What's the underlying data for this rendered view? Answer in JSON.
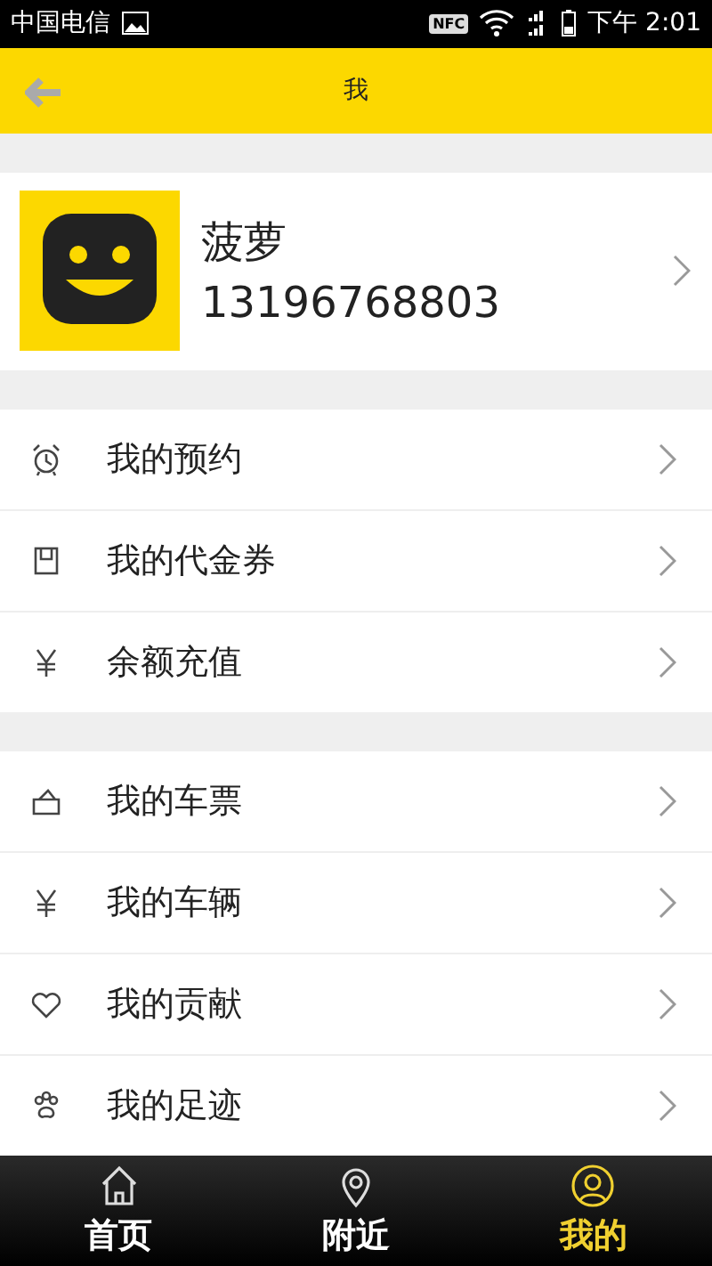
{
  "status_bar": {
    "carrier": "中国电信",
    "nfc": "NFC",
    "time": "下午 2:01"
  },
  "header": {
    "title": "我"
  },
  "profile": {
    "name": "菠萝",
    "phone": "13196768803"
  },
  "menu_groups": [
    {
      "items": [
        {
          "label": "我的预约"
        },
        {
          "label": "我的代金券"
        },
        {
          "label": "余额充值"
        }
      ]
    },
    {
      "items": [
        {
          "label": "我的车票"
        },
        {
          "label": "我的车辆"
        },
        {
          "label": "我的贡献"
        },
        {
          "label": "我的足迹"
        }
      ]
    }
  ],
  "tabs": [
    {
      "label": "首页",
      "selected": false
    },
    {
      "label": "附近",
      "selected": false
    },
    {
      "label": "我的",
      "selected": true
    }
  ]
}
